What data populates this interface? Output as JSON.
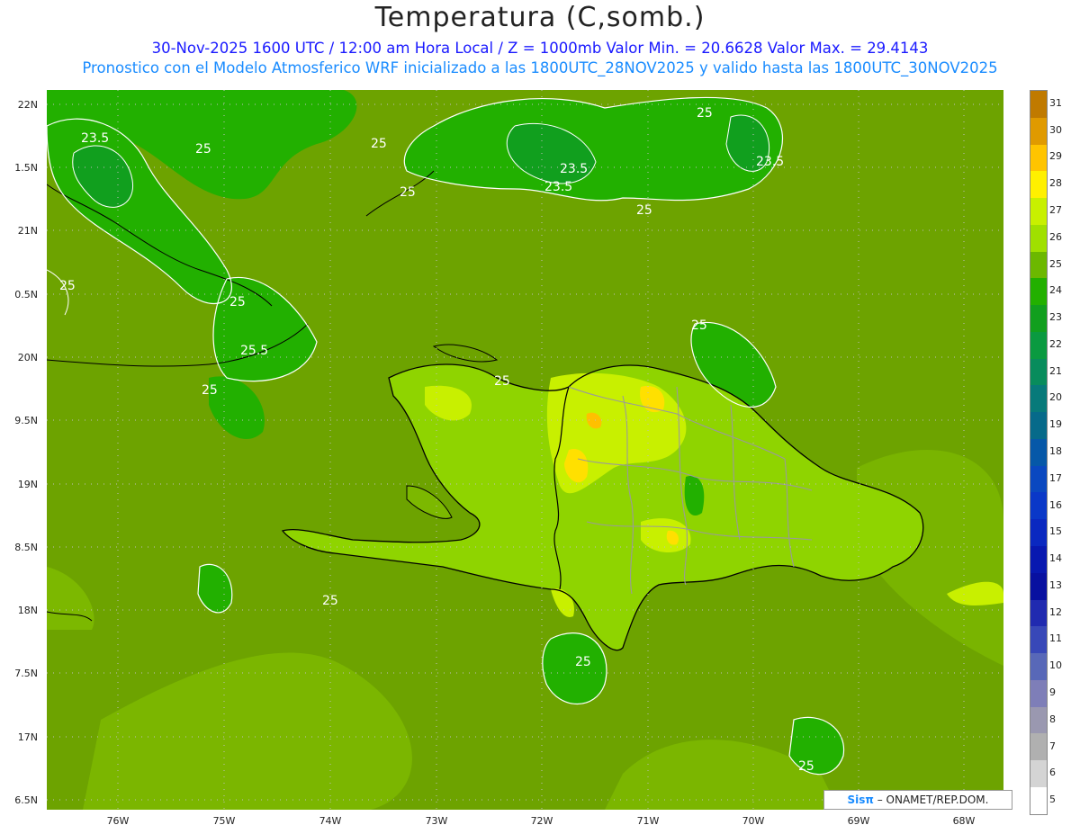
{
  "title": "Temperatura (C,somb.)",
  "subtitle1": "30-Nov-2025 1600 UTC / 12:00 am Hora Local / Z = 1000mb  Valor Min. = 20.6628  Valor Max. = 29.4143",
  "subtitle2": "Pronostico con el Modelo Atmosferico WRF inicializado a las 1800UTC_28NOV2025 y valido hasta las  1800UTC_30NOV2025",
  "credit": {
    "brand": "Sisπ",
    "text": " – ONAMET/REP.DOM."
  },
  "lat_labels": [
    "22N",
    "1.5N",
    "21N",
    "0.5N",
    "20N",
    "9.5N",
    "19N",
    "8.5N",
    "18N",
    "7.5N",
    "17N",
    "6.5N"
  ],
  "lon_labels": [
    "76W",
    "75W",
    "74W",
    "73W",
    "72W",
    "71W",
    "70W",
    "69W",
    "68W"
  ],
  "contour_labels": [
    "23.5",
    "25",
    "25",
    "25",
    "23.5",
    "23.5",
    "25",
    "23.5",
    "25",
    "25",
    "25",
    "25.5",
    "25",
    "25",
    "25",
    "25",
    "25",
    "25"
  ],
  "colorbar": {
    "labels": [
      "31",
      "30",
      "29",
      "28",
      "27",
      "26",
      "25",
      "24",
      "23",
      "22",
      "21",
      "20",
      "19",
      "18",
      "17",
      "16",
      "15",
      "14",
      "13",
      "12",
      "11",
      "10",
      "9",
      "8",
      "7",
      "6",
      "5"
    ],
    "colors": [
      "#c07a00",
      "#e09a00",
      "#ffc400",
      "#fff000",
      "#c8f000",
      "#a0e000",
      "#6cb800",
      "#22b000",
      "#119f1e",
      "#0a9a40",
      "#088c5c",
      "#077a7a",
      "#066a8a",
      "#0658a8",
      "#0a48c0",
      "#0a38c8",
      "#0a28c0",
      "#0818b0",
      "#0810a0",
      "#202ab0",
      "#3848b8",
      "#5868b8",
      "#7e7eb8",
      "#9a98b0",
      "#b0b0b0",
      "#d4d4d4",
      "#ffffff"
    ]
  },
  "map_colors": {
    "ocean": "#6da300",
    "warm": "#8fd400",
    "hot": "#c8f000",
    "hotter": "#ffe000",
    "peak": "#ffc000",
    "cool": "#2ea81c",
    "coast": "#000000",
    "border": "#9a9a9a",
    "isoline": "#ffffff"
  }
}
